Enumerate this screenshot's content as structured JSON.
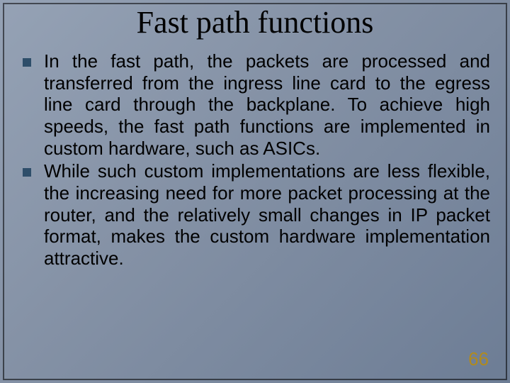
{
  "slide": {
    "title": "Fast path functions",
    "bullets": [
      "In the fast path, the packets are processed and transferred from the ingress line card to the egress line card through the backplane. To achieve high speeds, the fast path functions are implemented in custom hardware, such as ASICs.",
      "While such custom implementations are less flexible, the increasing need for more packet processing at the router, and the relatively small changes in IP packet format, makes the custom hardware implementation attractive."
    ],
    "page_number": "66"
  }
}
